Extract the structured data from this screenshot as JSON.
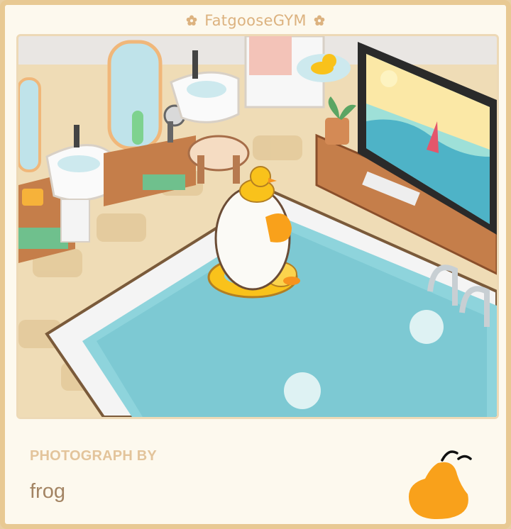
{
  "header": {
    "title": "FatgooseGYM",
    "left_icon": "flower-icon",
    "right_icon": "flower-icon"
  },
  "photo": {
    "scene": "bathroom-pool-scene"
  },
  "caption": {
    "label": "PHOTOGRAPH BY",
    "photographer": "frog",
    "logo_icon": "goose-logo-icon"
  },
  "colors": {
    "frame": "#e8c993",
    "title": "#dcb27f",
    "label": "#e3c49b",
    "name": "#a38463",
    "goose_orange": "#f9a11b"
  }
}
